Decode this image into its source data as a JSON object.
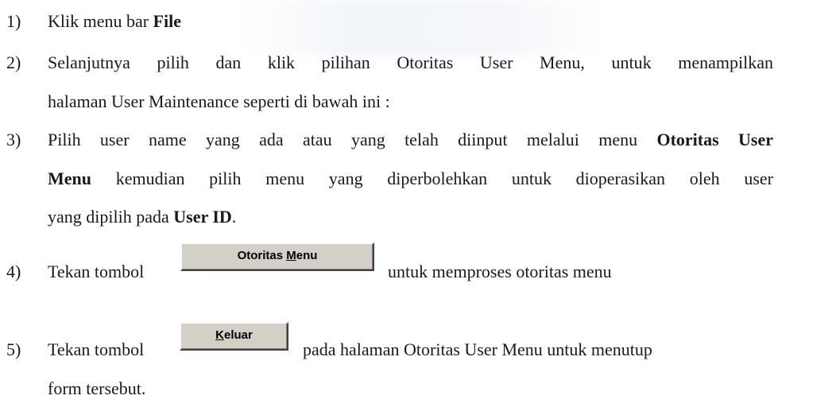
{
  "steps": [
    {
      "num": "1)",
      "pre": "Klik menu bar ",
      "bold": "File"
    },
    {
      "num": "2)",
      "line1": "Selanjutnya pilih dan klik pilihan Otoritas User Menu, untuk menampilkan",
      "line2": "halaman User Maintenance seperti di bawah ini :"
    },
    {
      "num": "3)",
      "line1_pre": "Pilih user name yang ada atau yang telah diinput melalui menu ",
      "line1_bold": "Otoritas User",
      "line2_bold": "Menu",
      "line2_post": " kemudian pilih menu yang diperbolehkan untuk dioperasikan oleh user",
      "line3_pre": "yang dipilih pada ",
      "line3_bold": "User ID",
      "line3_post": "."
    },
    {
      "num": "4)",
      "pre": "Tekan tombol",
      "button_pre": "Otoritas ",
      "button_u": "M",
      "button_post": "enu",
      "post": "untuk memproses otoritas menu"
    },
    {
      "num": "5)",
      "pre": "Tekan tombol",
      "button_u": "K",
      "button_post": "eluar",
      "post": "pada halaman Otoritas User Menu untuk menutup",
      "line2": "form tersebut."
    }
  ]
}
